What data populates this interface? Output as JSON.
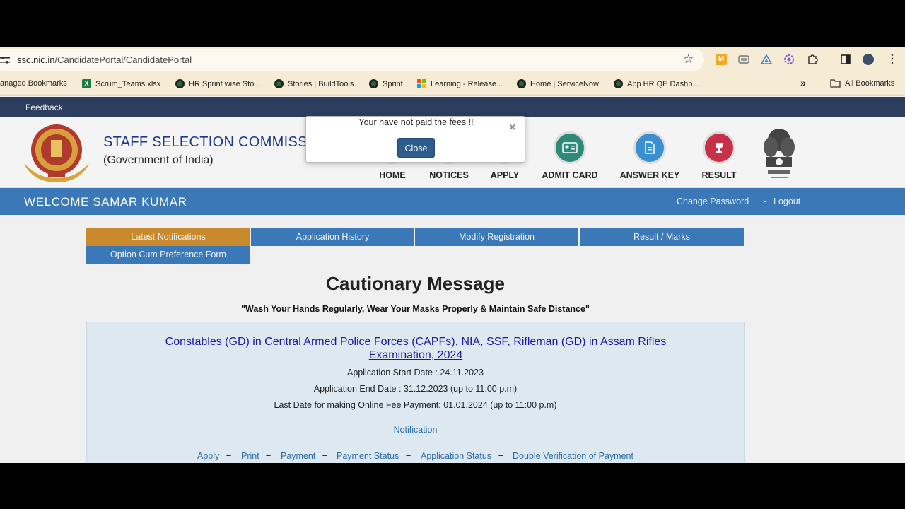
{
  "browser": {
    "url_host": "ssc.nic.in",
    "url_path": "/CandidatePortal/CandidatePortal",
    "bookmarks": [
      "anaged Bookmarks",
      "Scrum_Teams.xlsx",
      "HR Sprint wise Sto...",
      "Stories | BuildTools",
      "Sprint",
      "Learning - Release...",
      "Home | ServiceNow",
      "App HR QE Dashb..."
    ],
    "all_bookmarks": "All Bookmarks",
    "overflow": "»"
  },
  "site": {
    "feedback": "Feedback",
    "org_name": "STAFF SELECTION COMMISSION",
    "org_sub": "(Government of India)",
    "nav": [
      "HOME",
      "NOTICES",
      "APPLY",
      "ADMIT CARD",
      "ANSWER KEY",
      "RESULT"
    ],
    "welcome": "WELCOME SAMAR KUMAR",
    "change_password": "Change Password",
    "separator": "-",
    "logout": "Logout",
    "tabs": [
      "Latest Notifications",
      "Application History",
      "Modify Registration",
      "Result / Marks",
      "Option Cum Preference Form"
    ],
    "caution_title": "Cautionary Message",
    "caution_sub": "\"Wash Your Hands Regularly, Wear Your Masks Properly & Maintain Safe Distance\"",
    "exam": {
      "title": "Constables (GD) in Central Armed Police Forces (CAPFs), NIA, SSF, Rifleman (GD) in Assam Rifles Examination, 2024",
      "start": "Application Start Date : 24.11.2023",
      "end": "Application End Date : 31.12.2023 (up to 11:00 p.m)",
      "fee": "Last Date for making Online Fee Payment: 01.01.2024 (up to 11:00 p.m)",
      "notification": "Notification",
      "links": [
        "Apply",
        "Print",
        "Payment",
        "Payment Status",
        "Application Status",
        "Double Verification of Payment"
      ],
      "link_sep": "–"
    }
  },
  "modal": {
    "message": "Your have not paid the fees !!",
    "close_x": "×",
    "close_button": "Close"
  },
  "colors": {
    "brand_blue": "#3a78b8",
    "active_tab": "#c98a2e",
    "dark_bar": "#2c3e5d",
    "link": "#2a6ca8"
  }
}
